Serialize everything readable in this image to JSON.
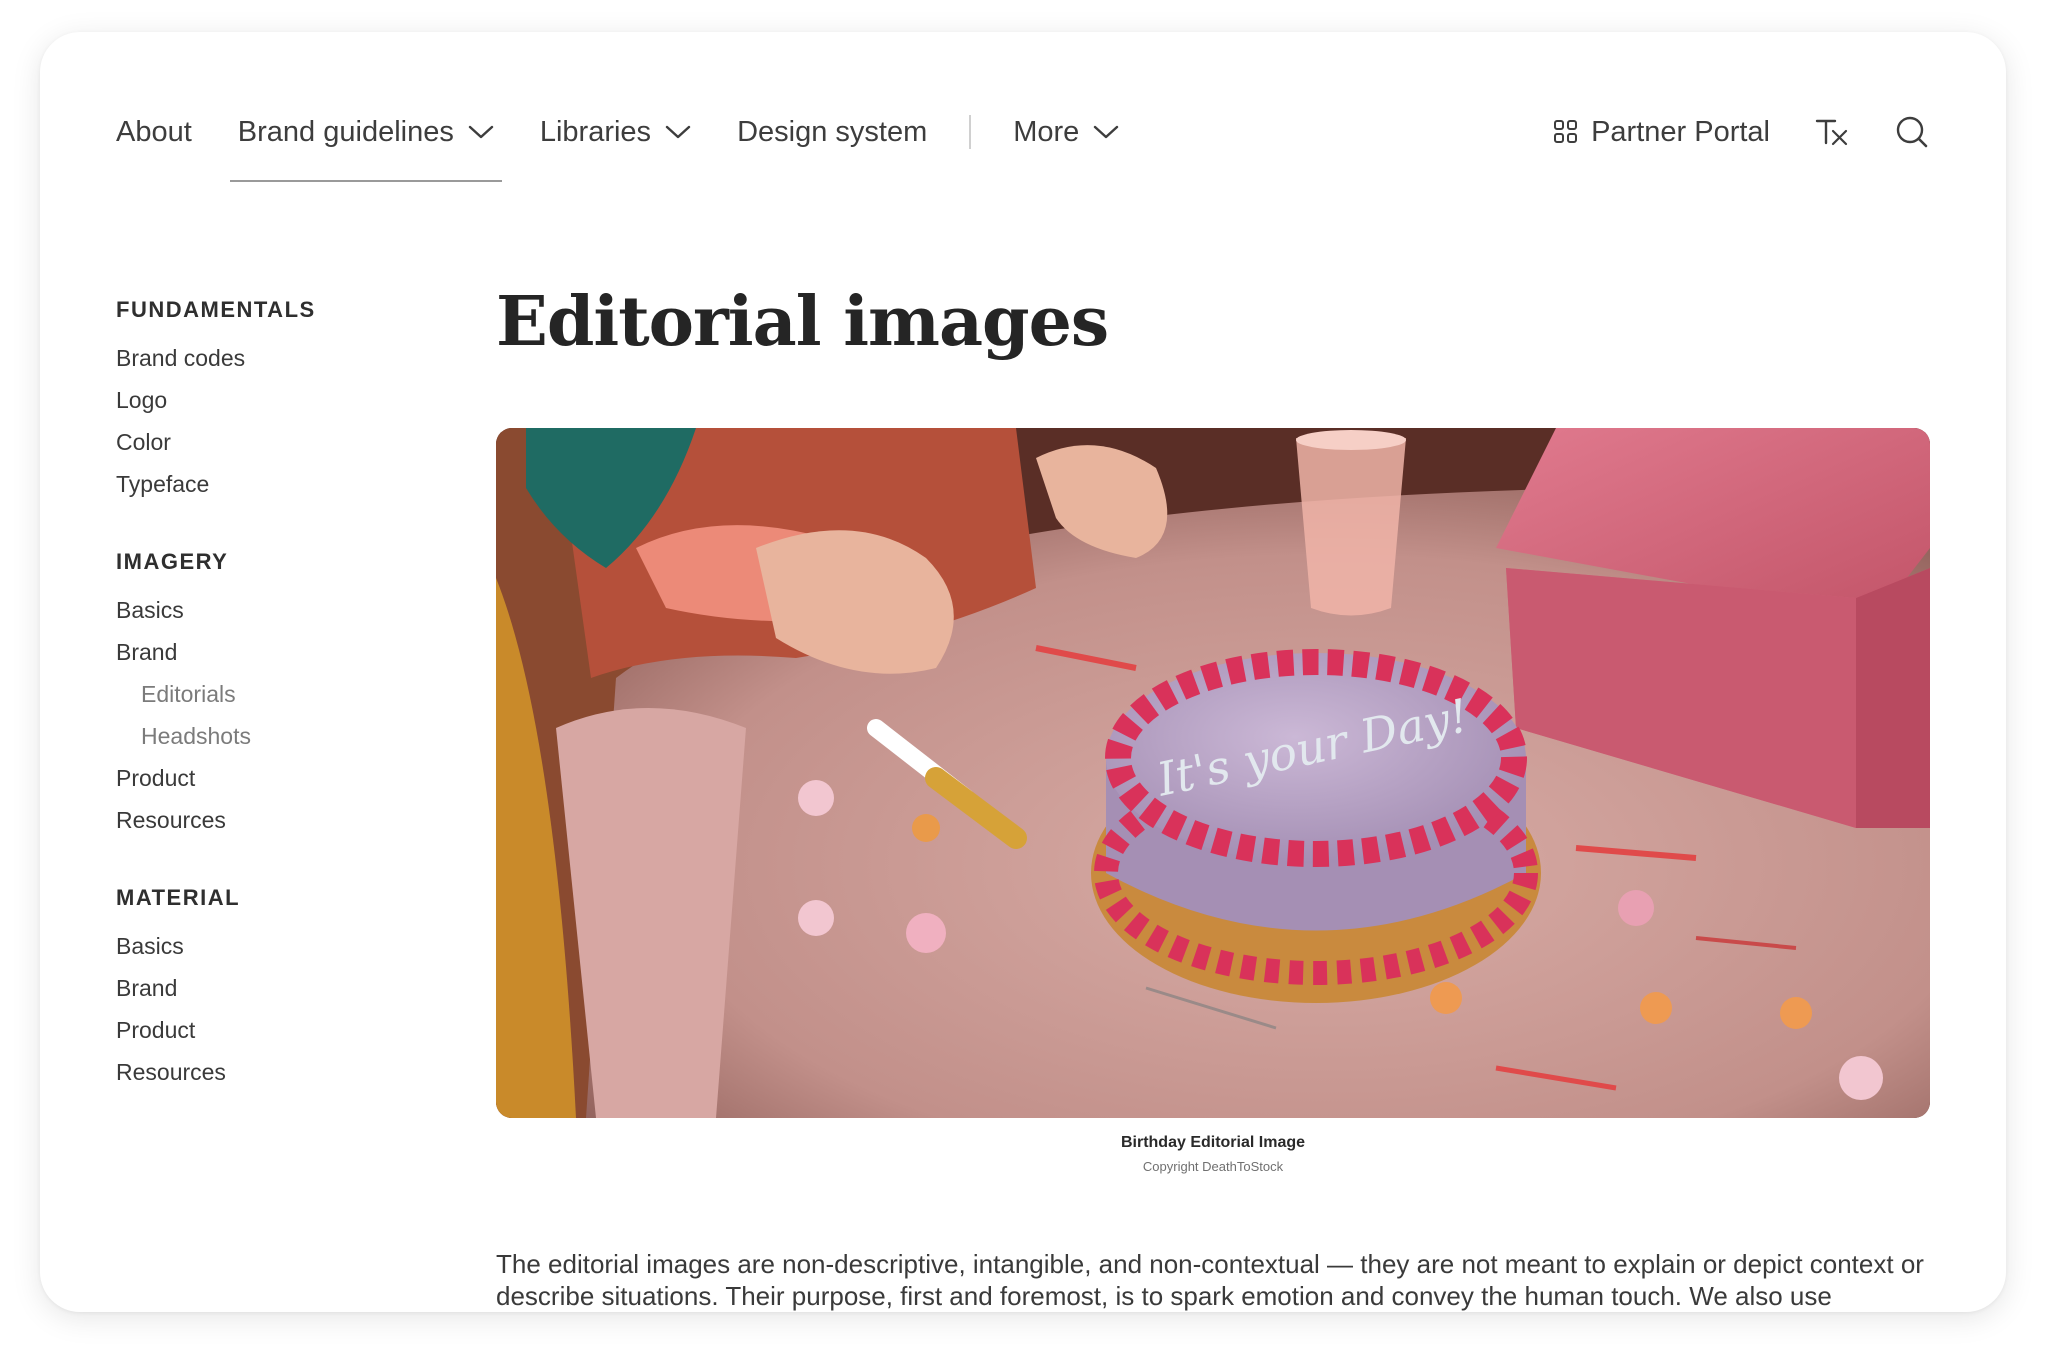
{
  "nav": {
    "items": [
      {
        "label": "About"
      },
      {
        "label": "Brand guidelines"
      },
      {
        "label": "Libraries"
      },
      {
        "label": "Design system"
      },
      {
        "label": "More"
      }
    ],
    "partner_portal": "Partner Portal",
    "icons": {
      "chevron": "chevron-down-icon",
      "partner_portal": "grid-icon",
      "clear_format": "clear-format-icon",
      "search": "search-icon"
    }
  },
  "sidebar": {
    "fundamentals": {
      "heading": "FUNDAMENTALS",
      "items": [
        "Brand codes",
        "Logo",
        "Color",
        "Typeface"
      ]
    },
    "imagery": {
      "heading": "IMAGERY",
      "items": [
        "Basics",
        "Brand"
      ],
      "sub_items": [
        "Editorials",
        "Headshots"
      ],
      "more_items": [
        "Product",
        "Resources"
      ]
    },
    "material": {
      "heading": "MATERIAL",
      "items": [
        "Basics",
        "Brand",
        "Product",
        "Resources"
      ]
    }
  },
  "main": {
    "title": "Editorial images",
    "hero": {
      "caption_title": "Birthday Editorial Image",
      "caption_sub": "Copyright DeathToStock",
      "cake_text": "It's your Day!"
    },
    "body": "The editorial images are non-descriptive, intangible, and non-contextual — they are not meant to explain or depict context or describe situations. Their purpose, first and foremost, is to spark emotion and convey the human touch. We also use editorial images to loosen up presentations."
  },
  "colors": {
    "text": "#3d3d3d",
    "heading": "#252525",
    "muted": "#7b7b7b",
    "cake_frosting": "#d9325a",
    "cake_top": "#b8a3c6",
    "tablecloth": "#c99b96",
    "gift_box": "#d5677c"
  }
}
